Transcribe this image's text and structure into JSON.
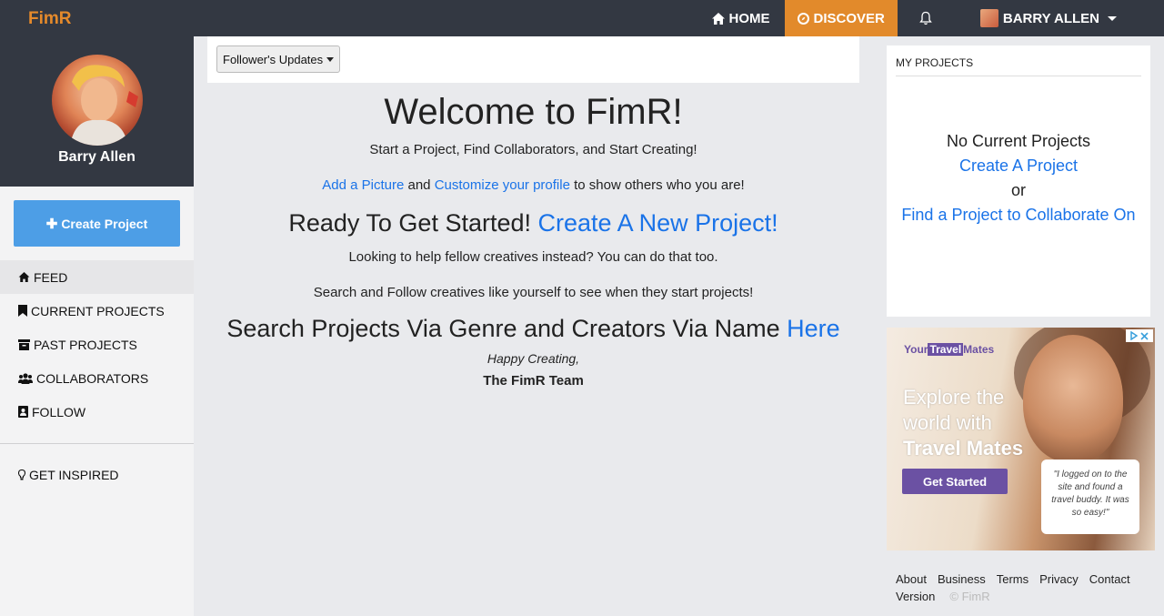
{
  "brand": "FimR",
  "nav": {
    "home": "HOME",
    "discover": "DISCOVER",
    "user": "BARRY ALLEN"
  },
  "sidebar": {
    "profile_name": "Barry Allen",
    "create_button": "Create Project",
    "items": [
      {
        "label": "FEED",
        "icon": "home-icon"
      },
      {
        "label": "CURRENT PROJECTS",
        "icon": "bookmark-icon"
      },
      {
        "label": "PAST PROJECTS",
        "icon": "archive-icon"
      },
      {
        "label": "COLLABORATORS",
        "icon": "users-icon"
      },
      {
        "label": "FOLLOW",
        "icon": "contact-icon"
      }
    ],
    "inspired": "GET INSPIRED"
  },
  "filter": {
    "dropdown": "Follower's Updates"
  },
  "welcome": {
    "title": "Welcome to FimR!",
    "subtitle": "Start a Project, Find Collaborators, and Start Creating!",
    "add_picture": "Add a Picture",
    "and": "and",
    "customize": "Customize your profile",
    "show_others": "to show others who you are!",
    "ready": "Ready To Get Started!",
    "create_new": "Create A New Project!",
    "help": "Looking to help fellow creatives instead? You can do that too.",
    "search_text": "Search and Follow creatives like yourself to see when they start projects!",
    "search_head": "Search Projects Via Genre and Creators Via Name",
    "here": "Here",
    "happy": "Happy Creating,",
    "team": "The FimR Team"
  },
  "projects": {
    "heading": "MY PROJECTS",
    "none": "No Current Projects",
    "create": "Create A Project",
    "or": "or",
    "find": "Find a Project to Collaborate On"
  },
  "ad": {
    "logo_a": "Your",
    "logo_b": "Travel",
    "logo_c": "Mates",
    "line1": "Explore the",
    "line2": "world with",
    "line3": "Travel Mates",
    "button": "Get Started",
    "quote": "\"I logged on to the site and found a travel buddy. It was so easy!\""
  },
  "footer": {
    "links": [
      "About",
      "Business",
      "Terms",
      "Privacy",
      "Contact",
      "Version"
    ],
    "copyright": "© FimR"
  }
}
